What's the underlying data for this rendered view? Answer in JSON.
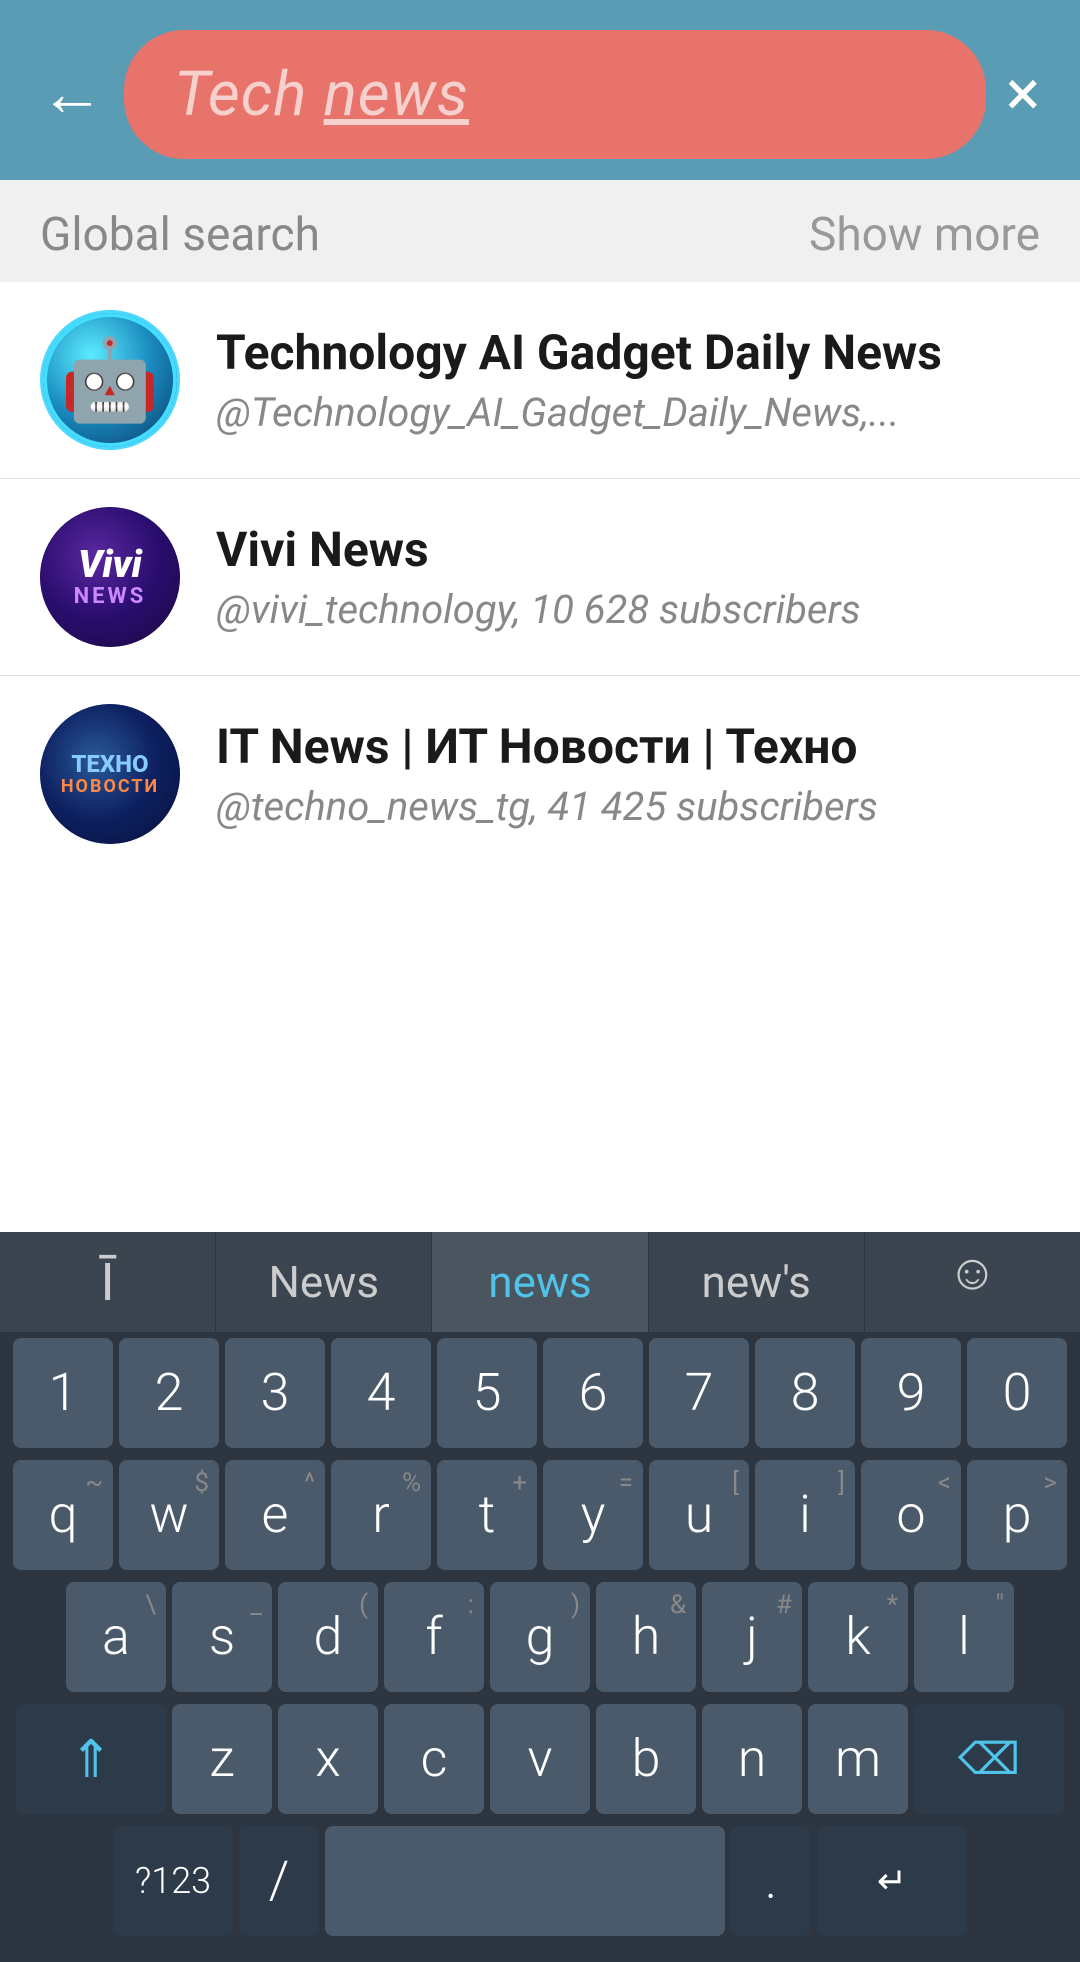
{
  "header": {
    "back_label": "←",
    "close_label": "×",
    "search_text_plain": "Tech ",
    "search_text_underline": "news"
  },
  "section": {
    "global_search_label": "Global search",
    "show_more_label": "Show more"
  },
  "results": [
    {
      "id": "result-1",
      "name": "Technology AI Gadget Daily News",
      "handle": "@Technology_AI_Gadget_Daily_News,...",
      "avatar_type": "robot"
    },
    {
      "id": "result-2",
      "name": "Vivi News",
      "handle": "@vivi_technology, 10 628 subscribers",
      "avatar_type": "vivi"
    },
    {
      "id": "result-3",
      "name": "IT News | ИТ Новости | Техно",
      "handle": "@techno_news_tg, 41 425 subscribers",
      "avatar_type": "techno"
    }
  ],
  "keyboard": {
    "suggestions": [
      {
        "id": "cursor",
        "label": "I"
      },
      {
        "id": "news-cap",
        "label": "News"
      },
      {
        "id": "news-lower",
        "label": "news"
      },
      {
        "id": "news-apos",
        "label": "new's"
      },
      {
        "id": "emoji",
        "label": "☺"
      }
    ],
    "rows": [
      {
        "id": "numbers",
        "keys": [
          {
            "main": "1",
            "top": ""
          },
          {
            "main": "2",
            "top": ""
          },
          {
            "main": "3",
            "top": ""
          },
          {
            "main": "4",
            "top": ""
          },
          {
            "main": "5",
            "top": ""
          },
          {
            "main": "6",
            "top": ""
          },
          {
            "main": "7",
            "top": ""
          },
          {
            "main": "8",
            "top": ""
          },
          {
            "main": "9",
            "top": ""
          },
          {
            "main": "0",
            "top": ""
          }
        ]
      },
      {
        "id": "qwerty",
        "keys": [
          {
            "main": "q",
            "top": "~"
          },
          {
            "main": "w",
            "top": "$"
          },
          {
            "main": "e",
            "top": "^"
          },
          {
            "main": "r",
            "top": "%"
          },
          {
            "main": "t",
            "top": "+"
          },
          {
            "main": "y",
            "top": "="
          },
          {
            "main": "u",
            "top": "["
          },
          {
            "main": "i",
            "top": "]"
          },
          {
            "main": "o",
            "top": "<"
          },
          {
            "main": "p",
            "top": ">"
          }
        ]
      },
      {
        "id": "asdf",
        "keys": [
          {
            "main": "a",
            "top": "\\"
          },
          {
            "main": "s",
            "top": "_"
          },
          {
            "main": "d",
            "top": "("
          },
          {
            "main": "f",
            "top": ":"
          },
          {
            "main": "g",
            "top": ")"
          },
          {
            "main": "h",
            "top": "&"
          },
          {
            "main": "j",
            "top": "#"
          },
          {
            "main": "k",
            "top": "*"
          },
          {
            "main": "l",
            "top": "\""
          }
        ]
      },
      {
        "id": "zxcv",
        "keys": [
          {
            "main": "z",
            "top": ""
          },
          {
            "main": "x",
            "top": ""
          },
          {
            "main": "c",
            "top": ""
          },
          {
            "main": "v",
            "top": ""
          },
          {
            "main": "b",
            "top": ""
          },
          {
            "main": "n",
            "top": ""
          },
          {
            "main": "m",
            "top": ""
          }
        ]
      }
    ]
  }
}
